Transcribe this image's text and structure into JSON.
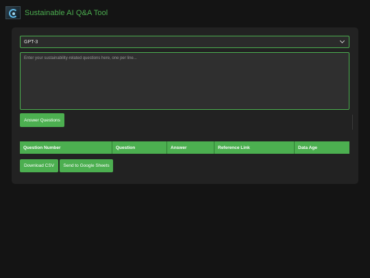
{
  "app": {
    "title": "Sustainable AI Q&A Tool",
    "logo_icon": "recycle-globe-icon"
  },
  "model_select": {
    "selected": "GPT-3",
    "icon": "chevron-down-icon"
  },
  "questions_input": {
    "value": "",
    "placeholder": "Enter your sustainability-related questions here, one per line..."
  },
  "buttons": {
    "answer": "Answer Questions",
    "download_csv": "Download CSV",
    "send_sheets": "Send to Google Sheets"
  },
  "table": {
    "columns": [
      "Question Number",
      "Question",
      "Answer",
      "Reference Link",
      "Data Age"
    ],
    "rows": []
  },
  "colors": {
    "accent": "#4caf50",
    "background": "#141414",
    "panel": "#222222"
  }
}
